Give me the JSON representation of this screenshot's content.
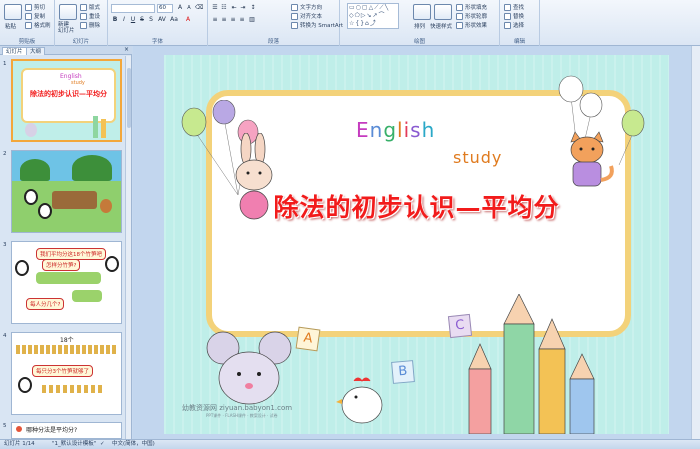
{
  "ribbon": {
    "clipboard": {
      "label": "剪贴板",
      "paste": "粘贴",
      "cut": "剪切",
      "copy": "复制",
      "format_painter": "格式刷"
    },
    "slides": {
      "label": "幻灯片",
      "new_slide": "新建\n幻灯片",
      "layout": "版式",
      "reset": "重设",
      "delete": "删除"
    },
    "font": {
      "label": "字体",
      "size": "60"
    },
    "paragraph": {
      "label": "段落",
      "text_direction": "文字方向",
      "align_text": "对齐文本",
      "smartart": "转换为 SmartArt"
    },
    "drawing": {
      "label": "绘图",
      "arrange": "排列",
      "quick_styles": "快速样式",
      "shape_fill": "形状填充",
      "shape_outline": "形状轮廓",
      "shape_effects": "形状效果"
    },
    "editing": {
      "label": "编辑",
      "find": "查找",
      "replace": "替换",
      "select": "选择"
    }
  },
  "pane": {
    "tabs": [
      "幻灯片",
      "大纲"
    ],
    "close": "×",
    "slides": [
      {
        "num": "1",
        "title": "除法的初步认识—平均分"
      },
      {
        "num": "2"
      },
      {
        "num": "3",
        "text1": "我们平均分这18个竹笋吧",
        "text2": "怎样分竹笋?",
        "text3": "每人分几个?"
      },
      {
        "num": "4",
        "count": "18个",
        "banner": "每只分3个竹笋就够了"
      },
      {
        "num": "5",
        "text": "哪种分法是平均分?"
      }
    ]
  },
  "slide": {
    "english": "English",
    "study": "study",
    "title": "除法的初步认识—平均分",
    "letters": [
      "A",
      "B",
      "C"
    ],
    "watermark": "幼教资源网 ziyuan.babyon1.com",
    "watermark_sub": "PPT课件 · FLASH课件 · 教案设计 · 试卷"
  },
  "status": {
    "slide_info": "幻灯片 1/14",
    "theme": "\"1_默认设计模板\"",
    "language": "中文(简体，中国)"
  },
  "colors": {
    "title": "#f21b1b",
    "frame": "#f3d27a",
    "slide_bg": "#bfeee9",
    "selected": "#f3a73b"
  }
}
